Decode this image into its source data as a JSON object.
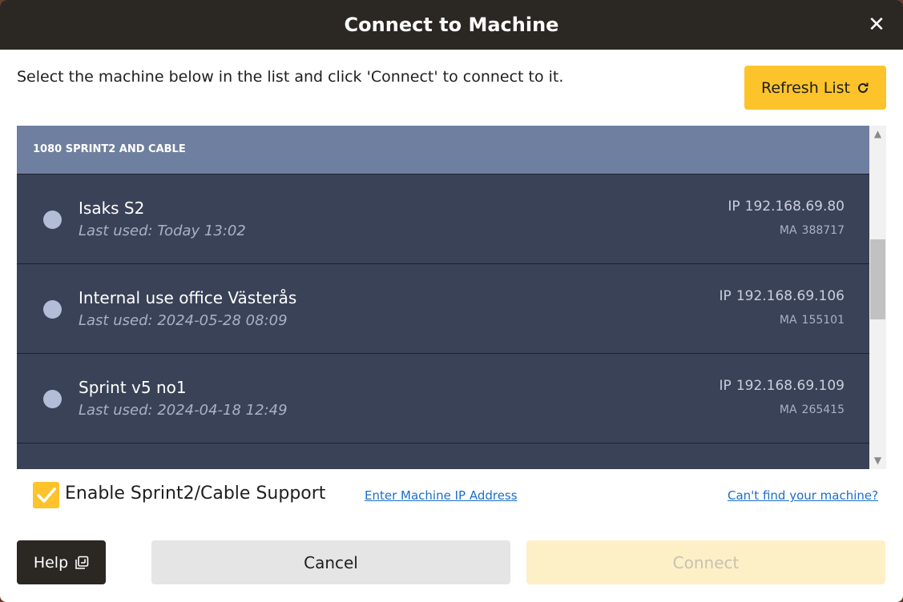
{
  "dialog": {
    "title": "Connect to Machine",
    "close_label": "✕",
    "instructions": "Select the machine below in the list and click 'Connect' to connect to it.",
    "refresh_label": "Refresh List"
  },
  "machine_list": {
    "group_label": "1080 SPRINT2 AND CABLE",
    "ip_prefix": "IP",
    "ma_prefix": "MA",
    "machines": [
      {
        "name": "Isaks S2",
        "last_used_prefix": "Last used:",
        "last_used": "Today 13:02",
        "ip": "192.168.69.80",
        "ma": "388717"
      },
      {
        "name": "Internal use office Västerås",
        "last_used_prefix": "Last used:",
        "last_used": "2024-05-28 08:09",
        "ip": "192.168.69.106",
        "ma": "155101"
      },
      {
        "name": "Sprint v5 no1",
        "last_used_prefix": "Last used:",
        "last_used": "2024-04-18 12:49",
        "ip": "192.168.69.109",
        "ma": "265415"
      }
    ]
  },
  "options": {
    "sprint2_support_label": "Enable Sprint2/Cable Support",
    "sprint2_support_checked": true,
    "enter_ip_link": "Enter Machine IP Address",
    "cant_find_link": "Can't find your machine?"
  },
  "footer": {
    "help_label": "Help",
    "cancel_label": "Cancel",
    "connect_label": "Connect"
  },
  "colors": {
    "accent": "#fdc32b",
    "titlebar": "#2b2723",
    "list_bg": "#3a4257",
    "group_header": "#6f7f9f",
    "link": "#1a6fc9"
  }
}
